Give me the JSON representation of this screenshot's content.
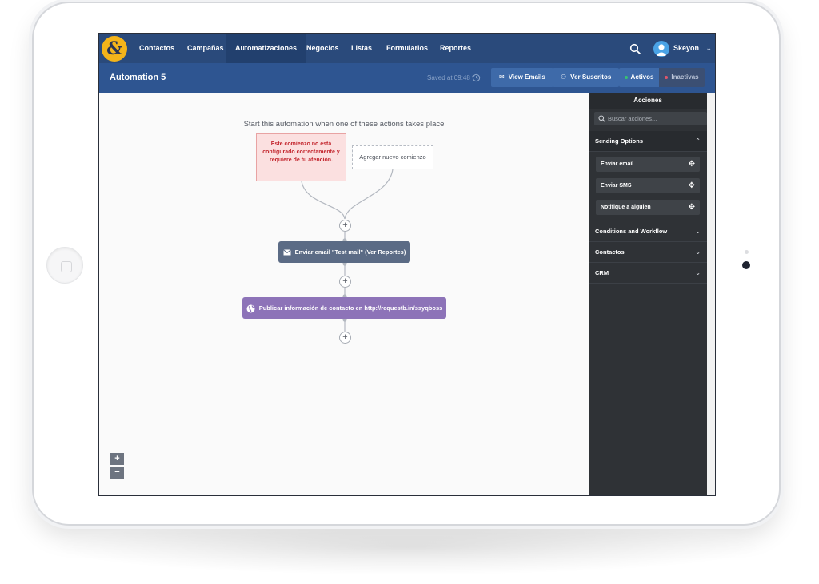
{
  "nav": {
    "logo": "&",
    "items": [
      {
        "label": "Contactos",
        "active": false
      },
      {
        "label": "Campañas",
        "active": false
      },
      {
        "label": "Automatizaciones",
        "active": true
      },
      {
        "label": "Negocios",
        "active": false
      },
      {
        "label": "Listas",
        "active": false
      },
      {
        "label": "Formularios",
        "active": false
      },
      {
        "label": "Reportes",
        "active": false
      }
    ],
    "user_name": "Skeyon",
    "user_chevron": "⌄"
  },
  "header": {
    "title": "Automation 5",
    "saved": "Saved at 09:48",
    "view_emails": "View Emails",
    "ver_suscritos": "Ver Suscritos",
    "activos": "Activos",
    "inactivas": "Inactivas"
  },
  "canvas": {
    "caption": "Start this automation when one of these actions takes place",
    "error_trigger": "Este comienzo no está configurado correctamente y requiere de tu atención.",
    "add_trigger": "Agregar nuevo comienzo",
    "email_step": "Enviar email \"Test mail\" (Ver Reportes)",
    "publish_step": "Publicar información de contacto en http://requestb.in/ssyqboss",
    "plus": "+",
    "zoom_in": "+",
    "zoom_out": "−"
  },
  "sidebar": {
    "title": "Acciones",
    "search_placeholder": "Buscar acciones...",
    "sections": [
      {
        "label": "Sending Options",
        "open": true,
        "chevron": "⌃"
      },
      {
        "label": "Conditions and Workflow",
        "open": false,
        "chevron": "⌄"
      },
      {
        "label": "Contactos",
        "open": false,
        "chevron": "⌄"
      },
      {
        "label": "CRM",
        "open": false,
        "chevron": "⌄"
      }
    ],
    "actions": [
      {
        "label": "Enviar email"
      },
      {
        "label": "Enviar SMS"
      },
      {
        "label": "Notifique a alguien"
      }
    ],
    "move_glyph": "✥"
  },
  "colors": {
    "nav_bg": "#2a4a7b",
    "header_bg": "#2e5591",
    "logo": "#f4b41a",
    "email_step": "#5b6b85",
    "publish_step": "#8d73b8",
    "error": "#c3262e",
    "active_dot": "#38c172",
    "inactive_dot": "#e0566b"
  },
  "icons": [
    "logo-icon",
    "search-icon",
    "avatar-icon",
    "history-icon",
    "envelope-icon",
    "people-icon",
    "globe-icon",
    "move-icon",
    "chevron-icon"
  ]
}
